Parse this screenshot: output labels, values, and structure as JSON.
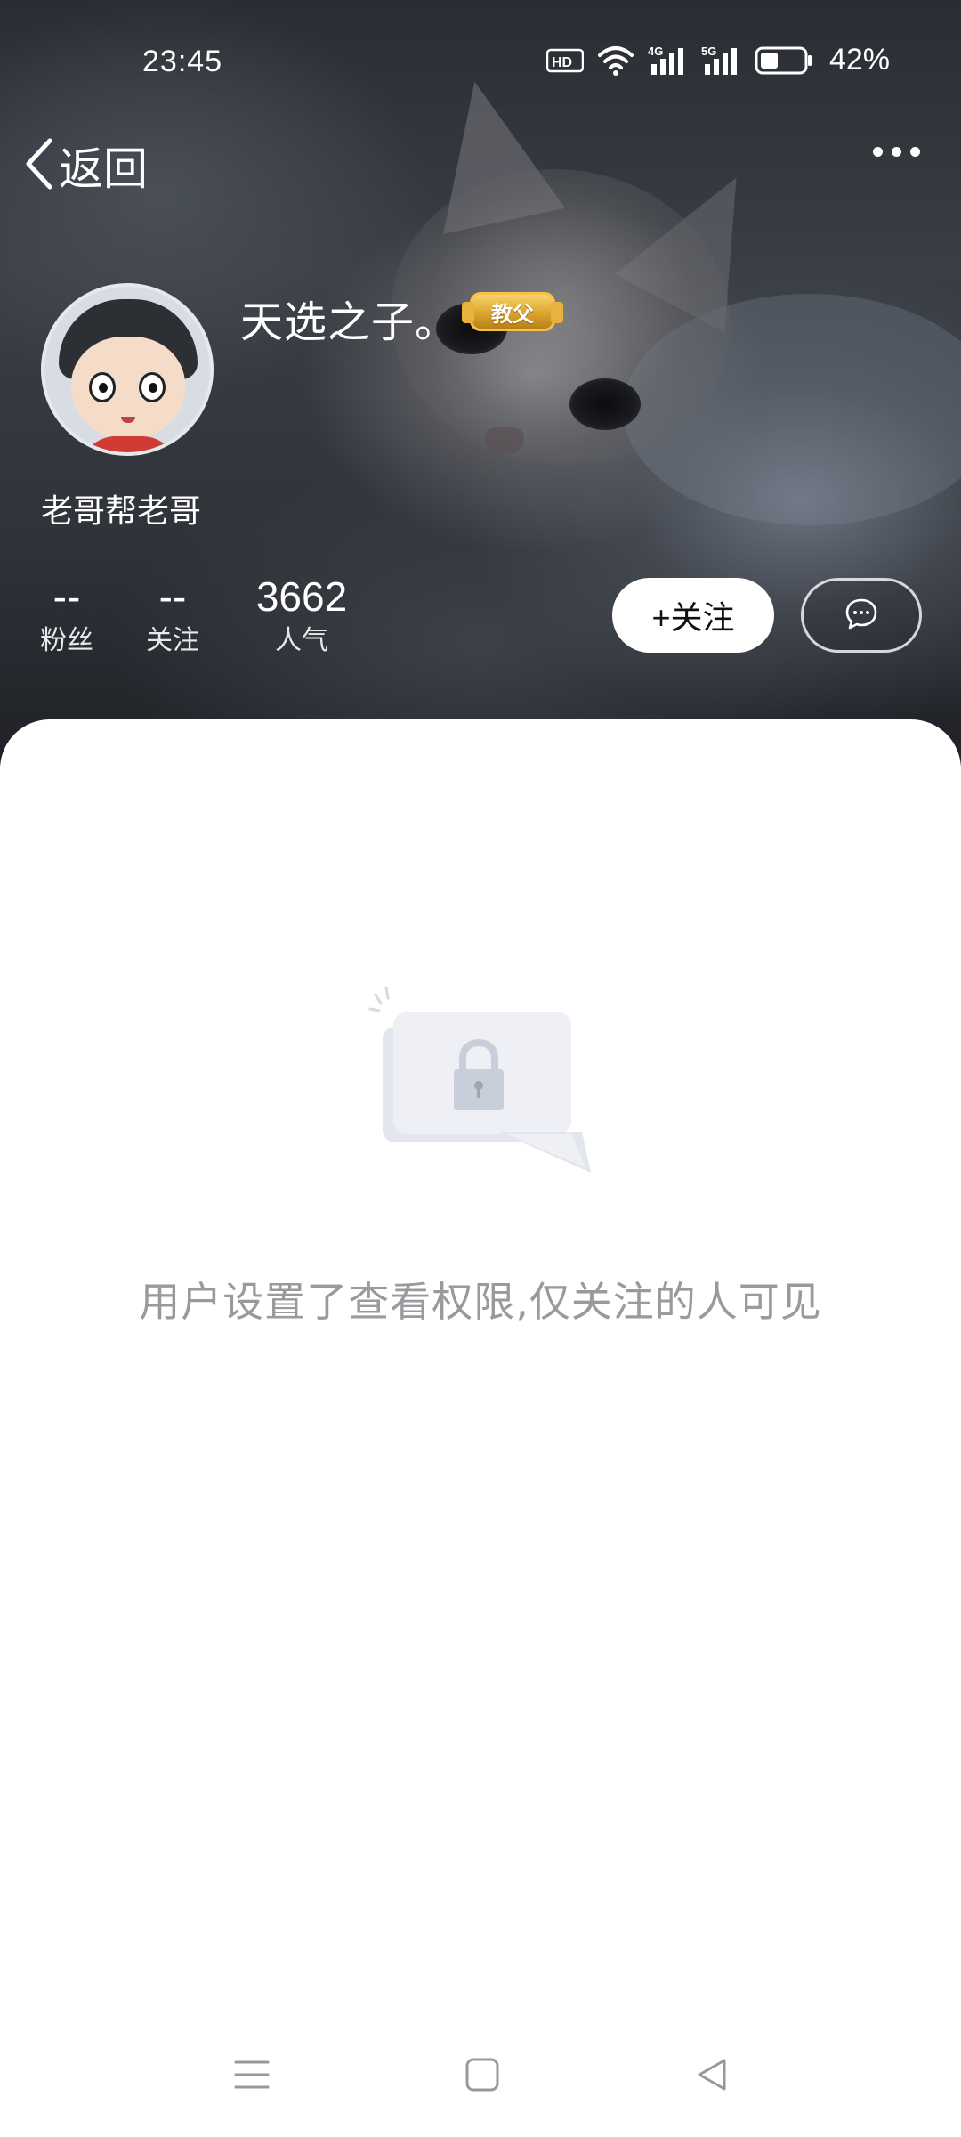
{
  "status_bar": {
    "time": "23:45",
    "battery_percent": "42%",
    "network_left": "4G",
    "network_right": "5G",
    "hd_label": "HD",
    "battery_level": 0.42
  },
  "nav": {
    "back_label": "返回"
  },
  "profile": {
    "display_name": "天选之子。",
    "badge": "教父",
    "username": "老哥帮老哥",
    "stats": {
      "fans_value": "--",
      "fans_label": "粉丝",
      "follow_value": "--",
      "follow_label": "关注",
      "popularity_value": "3662",
      "popularity_label": "人气"
    },
    "follow_button": "+关注"
  },
  "content": {
    "privacy_message": "用户设置了查看权限,仅关注的人可见"
  },
  "icons": {
    "back": "chevron-left-icon",
    "more": "more-dots-icon",
    "message": "chat-bubble-icon",
    "lock": "lock-icon",
    "menu": "menu-icon",
    "home": "home-square-icon",
    "back_nav": "triangle-back-icon"
  },
  "colors": {
    "follow_button_bg": "#ffffff",
    "message_text": "#9a9a9e",
    "badge_gold": "#d8a02a"
  }
}
